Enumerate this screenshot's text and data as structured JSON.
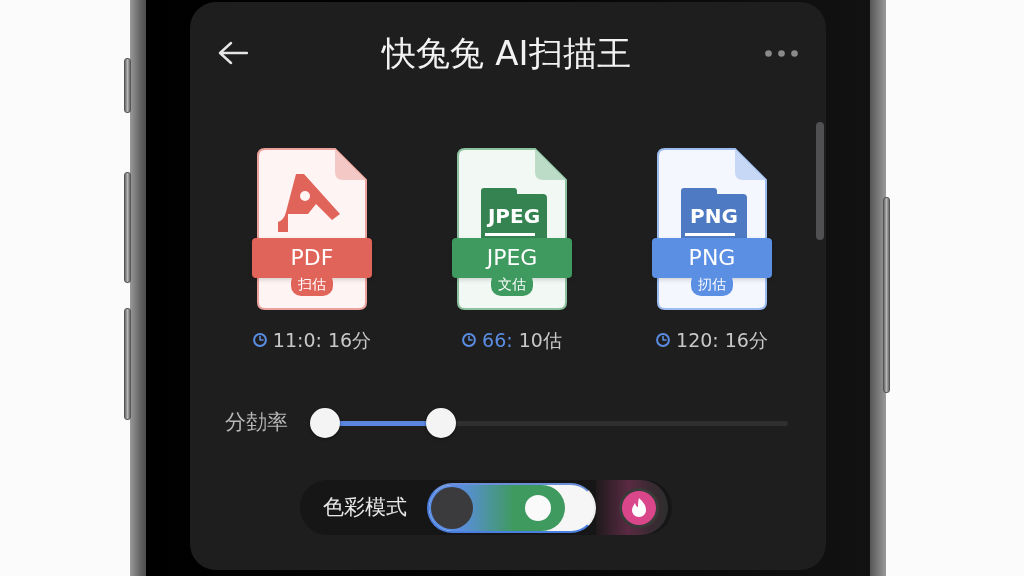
{
  "header": {
    "title": "快兔兔 AI扫描王"
  },
  "files": [
    {
      "kind": "pdf",
      "color": "#e0645a",
      "format": "PDF",
      "tag": "扫估",
      "count": "11:0:",
      "count_highlighted": false,
      "duration": "16分"
    },
    {
      "kind": "folder",
      "color": "#3f9a60",
      "inner_label": "JPEG",
      "format": "JPEG",
      "tag": "文估",
      "count": "66:",
      "count_highlighted": true,
      "duration": "10估"
    },
    {
      "kind": "folder",
      "color": "#5b8fe4",
      "inner_label": "PNG",
      "format": "PNG",
      "tag": "扨估",
      "count": "120:",
      "count_highlighted": false,
      "duration": "16分"
    }
  ],
  "slider": {
    "label": "分勎率",
    "thumbs": [
      {
        "level": 0
      },
      {
        "level": 0.26
      }
    ]
  },
  "color_mode": {
    "label": "色彩模式",
    "on": true
  }
}
